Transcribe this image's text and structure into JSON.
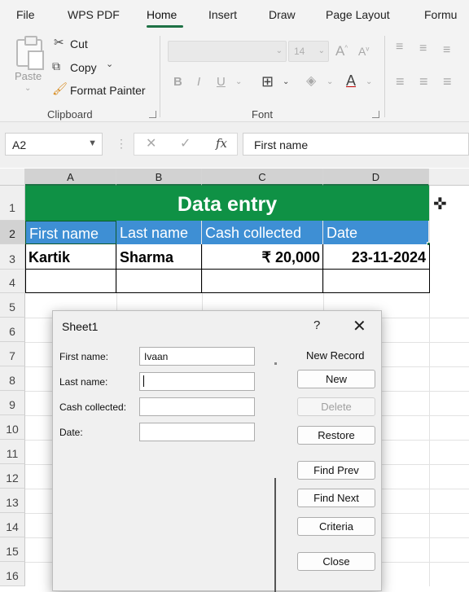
{
  "menu": {
    "items": [
      "File",
      "WPS PDF",
      "Home",
      "Insert",
      "Draw",
      "Page Layout",
      "Formu"
    ],
    "active": "Home"
  },
  "ribbon": {
    "clipboard": {
      "paste_label": "Paste",
      "cut_label": "Cut",
      "copy_label": "Copy",
      "format_painter_label": "Format Painter",
      "group_label": "Clipboard"
    },
    "font": {
      "font_name": "",
      "font_size": "14",
      "group_label": "Font"
    }
  },
  "formula_bar": {
    "name_box": "A2",
    "fx_symbol": "fx",
    "content": "First name"
  },
  "grid": {
    "columns": [
      "A",
      "B",
      "C",
      "D"
    ],
    "rows": [
      "1",
      "2",
      "3",
      "4",
      "5",
      "6",
      "7",
      "8",
      "9",
      "10",
      "11",
      "12",
      "13",
      "14",
      "15",
      "16"
    ],
    "title": "Data entry",
    "headers": [
      "First name",
      "Last name",
      "Cash collected",
      "Date"
    ],
    "record": {
      "first_name": "Kartik",
      "last_name": "Sharma",
      "cash": "₹ 20,000",
      "date": "23-11-2024"
    }
  },
  "dialog": {
    "title": "Sheet1",
    "help": "?",
    "record_label": "New Record",
    "fields": {
      "first_name_label": "First name:",
      "first_name_value": "Ivaan",
      "last_name_label": "Last name:",
      "last_name_value": "",
      "cash_label": "Cash collected:",
      "cash_value": "",
      "date_label": "Date:",
      "date_value": ""
    },
    "buttons": {
      "new": "New",
      "delete": "Delete",
      "restore": "Restore",
      "find_prev": "Find Prev",
      "find_next": "Find Next",
      "criteria": "Criteria",
      "close": "Close"
    }
  },
  "colors": {
    "title_green": "#0f9145",
    "header_blue": "#3e8fd4",
    "accent_green": "#1e7145"
  }
}
